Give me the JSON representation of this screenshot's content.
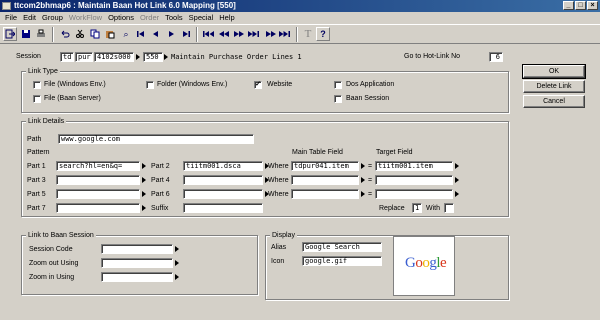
{
  "window": {
    "title": "ttcom2bhmap6 : Maintain Baan Hot Link 6.0 Mapping [550]",
    "min": "_",
    "max": "□",
    "close": "×"
  },
  "menu": [
    {
      "label": "File",
      "enabled": true
    },
    {
      "label": "Edit",
      "enabled": true
    },
    {
      "label": "Group",
      "enabled": true
    },
    {
      "label": "WorkFlow",
      "enabled": false
    },
    {
      "label": "Options",
      "enabled": true
    },
    {
      "label": "Order",
      "enabled": false
    },
    {
      "label": "Tools",
      "enabled": true
    },
    {
      "label": "Special",
      "enabled": true
    },
    {
      "label": "Help",
      "enabled": true
    }
  ],
  "toolbar": {
    "find_glyph": "⌕",
    "text_glyph": "T",
    "help_glyph": "?"
  },
  "session": {
    "label": "Session",
    "package": "td",
    "module": "pur",
    "code": "4102s000",
    "company": "550",
    "description": "Maintain Purchase Order Lines 1"
  },
  "goto_hotlink": {
    "label": "Go to Hot-Link No",
    "value": "6"
  },
  "link_type": {
    "title": "Link Type",
    "options": [
      {
        "label": "File (Windows Env.)",
        "checked": false
      },
      {
        "label": "File (Baan Server)",
        "checked": false
      },
      {
        "label": "Folder (Windows Env.)",
        "checked": false
      },
      {
        "label": "Website",
        "checked": true
      },
      {
        "label": "Dos Application",
        "checked": false
      },
      {
        "label": "Baan Session",
        "checked": false
      }
    ]
  },
  "buttons": {
    "ok": "OK",
    "delete": "Delete Link",
    "cancel": "Cancel"
  },
  "link_details": {
    "title": "Link Details",
    "path_label": "Path",
    "path_value": "www.google.com",
    "pattern_label": "Pattern",
    "main_table_field_label": "Main Table Field",
    "target_field_label": "Target Field",
    "parts": [
      {
        "label": "Part 1",
        "value": "search?hl=en&q="
      },
      {
        "label": "Part 2",
        "value": "tiitm001.dsca"
      },
      {
        "label": "Part 3",
        "value": ""
      },
      {
        "label": "Part 4",
        "value": ""
      },
      {
        "label": "Part 5",
        "value": ""
      },
      {
        "label": "Part 6",
        "value": ""
      },
      {
        "label": "Part 7",
        "value": ""
      }
    ],
    "suffix_label": "Suffix",
    "suffix_value": "",
    "where_label": "Where",
    "eq": "=",
    "conditions": [
      {
        "main": "tdpur041.item",
        "target": "tiitm001.item"
      },
      {
        "main": "",
        "target": ""
      },
      {
        "main": "",
        "target": ""
      }
    ],
    "replace_label": "Replace",
    "replace_value": "1",
    "with_label": "With",
    "with_value": ""
  },
  "baan_session": {
    "title": "Link to Baan Session",
    "session_code_label": "Session Code",
    "zoom_out_label": "Zoom out Using",
    "zoom_in_label": "Zoom in Using"
  },
  "display": {
    "title": "Display",
    "alias_label": "Alias",
    "alias_value": "Google Search",
    "icon_label": "Icon",
    "icon_value": "google.gif"
  },
  "logo": {
    "letters": [
      "G",
      "o",
      "o",
      "g",
      "l",
      "e"
    ],
    "colors": [
      "#3b5fd1",
      "#d8351b",
      "#efb300",
      "#3b5fd1",
      "#2e9a34",
      "#d8351b"
    ]
  }
}
